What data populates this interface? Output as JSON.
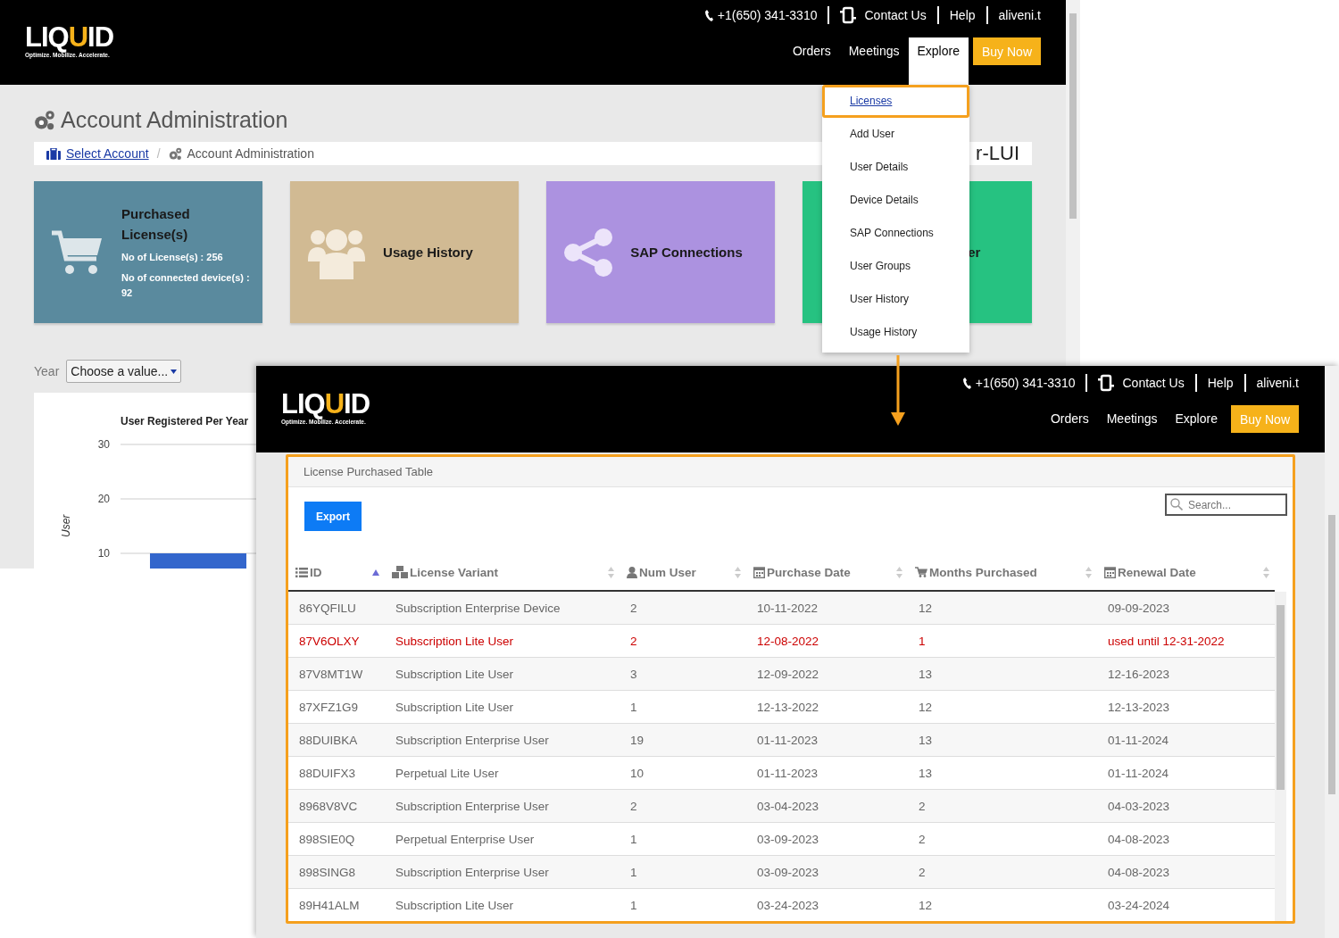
{
  "back_window": {
    "header": {
      "logo": {
        "parts": [
          {
            "text": "LIQ",
            "accent": false
          },
          {
            "text": "U",
            "accent": true
          },
          {
            "text": "ID",
            "accent": false
          }
        ],
        "tagline": "Optimize. Mobilize. Accelerate."
      },
      "phone": "+1(650) 341-3310",
      "contact": "Contact Us",
      "help": "Help",
      "user": "aliveni.t",
      "nav": [
        {
          "label": "Orders",
          "selected": false
        },
        {
          "label": "Meetings",
          "selected": false
        },
        {
          "label": "Explore",
          "selected": true
        }
      ],
      "cta": "Buy Now"
    },
    "page_title": "Account Administration",
    "breadcrumb": [
      {
        "label": "Select Account",
        "link": true
      },
      {
        "label": "Account Administration",
        "link": false
      }
    ],
    "breadcrumb_separator": "/",
    "breadcrumb_right": "r-LUI",
    "cards": [
      {
        "title": "Purchased License(s)",
        "details": [
          "No of License(s) : 256",
          "No of connected device(s) : 92"
        ],
        "color": "#5a8a9e"
      },
      {
        "title": "Usage History",
        "color": "#d1ba93"
      },
      {
        "title": "SAP Connections",
        "color": "#ac92e0"
      },
      {
        "title": "er",
        "color": "#26c281"
      }
    ],
    "filter": {
      "label": "Year",
      "placeholder": "Choose a value..."
    },
    "chart": {
      "chart_data": {
        "type": "bar",
        "title": "User Registered Per Year",
        "ylabel": "User",
        "ylim": [
          0,
          30
        ],
        "yticks": [
          10,
          20,
          30
        ],
        "values": [
          10
        ]
      }
    },
    "menu": [
      {
        "label": "Licenses",
        "selected": true
      },
      {
        "label": "Add User",
        "selected": false
      },
      {
        "label": "User Details",
        "selected": false
      },
      {
        "label": "Device Details",
        "selected": false
      },
      {
        "label": "SAP Connections",
        "selected": false
      },
      {
        "label": "User Groups",
        "selected": false
      },
      {
        "label": "User History",
        "selected": false
      },
      {
        "label": "Usage History",
        "selected": false
      }
    ]
  },
  "front_window": {
    "header": {
      "logo": {
        "parts": [
          {
            "text": "LIQ",
            "accent": false
          },
          {
            "text": "U",
            "accent": true
          },
          {
            "text": "ID",
            "accent": false
          }
        ],
        "tagline": "Optimize. Mobilize. Accelerate."
      },
      "phone": "+1(650) 341-3310",
      "contact": "Contact Us",
      "help": "Help",
      "user": "aliveni.t",
      "nav": [
        {
          "label": "Orders",
          "selected": false
        },
        {
          "label": "Meetings",
          "selected": false
        },
        {
          "label": "Explore",
          "selected": false
        }
      ],
      "cta": "Buy Now"
    },
    "panel_title": "License Purchased Table",
    "export_button": "Export",
    "search": {
      "placeholder": "Search..."
    },
    "table": {
      "columns": [
        {
          "label": "ID",
          "sorted": true
        },
        {
          "label": "License Variant",
          "sorted": false
        },
        {
          "label": "Num User",
          "sorted": false
        },
        {
          "label": "Purchase Date",
          "sorted": false
        },
        {
          "label": "Months Purchased",
          "sorted": false
        },
        {
          "label": "Renewal Date",
          "sorted": false
        }
      ],
      "rows": [
        {
          "cells": [
            "86YQFILU",
            "Subscription Enterprise Device",
            "2",
            "10-11-2022",
            "12",
            "09-09-2023"
          ],
          "warning": false
        },
        {
          "cells": [
            "87V6OLXY",
            "Subscription Lite User",
            "2",
            "12-08-2022",
            "1",
            "used until 12-31-2022"
          ],
          "warning": true
        },
        {
          "cells": [
            "87V8MT1W",
            "Subscription Lite User",
            "3",
            "12-09-2022",
            "13",
            "12-16-2023"
          ],
          "warning": false
        },
        {
          "cells": [
            "87XFZ1G9",
            "Subscription Lite User",
            "1",
            "12-13-2022",
            "12",
            "12-13-2023"
          ],
          "warning": false
        },
        {
          "cells": [
            "88DUIBKA",
            "Subscription Enterprise User",
            "19",
            "01-11-2023",
            "13",
            "01-11-2024"
          ],
          "warning": false
        },
        {
          "cells": [
            "88DUIFX3",
            "Perpetual Lite User",
            "10",
            "01-11-2023",
            "13",
            "01-11-2024"
          ],
          "warning": false
        },
        {
          "cells": [
            "8968V8VC",
            "Subscription Enterprise User",
            "2",
            "03-04-2023",
            "2",
            "04-03-2023"
          ],
          "warning": false
        },
        {
          "cells": [
            "898SIE0Q",
            "Perpetual Enterprise User",
            "1",
            "03-09-2023",
            "2",
            "04-08-2023"
          ],
          "warning": false
        },
        {
          "cells": [
            "898SING8",
            "Subscription Enterprise User",
            "1",
            "03-09-2023",
            "2",
            "04-08-2023"
          ],
          "warning": false
        },
        {
          "cells": [
            "89H41ALM",
            "Subscription Lite User",
            "1",
            "03-24-2023",
            "12",
            "03-24-2024"
          ],
          "warning": false
        }
      ]
    }
  }
}
